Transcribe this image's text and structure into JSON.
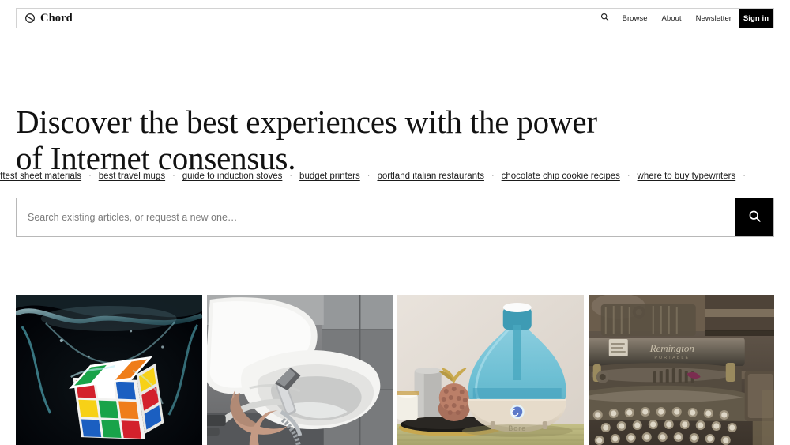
{
  "header": {
    "brand": "Chord",
    "brand_icon": "chord-circle-logo",
    "search_icon": "search-icon",
    "nav": [
      {
        "label": "Browse",
        "name": "nav-browse"
      },
      {
        "label": "About",
        "name": "nav-about"
      },
      {
        "label": "Newsletter",
        "name": "nav-newsletter"
      }
    ],
    "sign_in": "Sign in",
    "sign_in_bg": "#000000",
    "sign_in_fg": "#ffffff"
  },
  "hero": {
    "headline_line1": "Discover the best experiences with the power",
    "headline_line2": "of Internet consensus."
  },
  "ticker": {
    "separator": "·",
    "items": [
      "softest sheet materials",
      "best travel mugs",
      "guide to induction stoves",
      "budget printers",
      "portland italian restaurants",
      "chocolate chip cookie recipes",
      "where to buy typewriters"
    ]
  },
  "search": {
    "placeholder": "Search existing articles, or request a new one…",
    "value": "",
    "submit_icon": "search-icon",
    "submit_bg": "#000000"
  },
  "gallery": {
    "cards": [
      {
        "name": "card-rubiks-cube-water",
        "alt": "Rubik's cube splashing into dark water"
      },
      {
        "name": "card-bidet-sprayer-toilet",
        "alt": "Hand holding a bidet sprayer over a white toilet"
      },
      {
        "name": "card-humidifier",
        "alt": "Blue cool mist humidifier on a table with candles and pineapple decor"
      },
      {
        "name": "card-vintage-typewriter",
        "alt": "Dusty vintage Remington typewriter"
      }
    ]
  },
  "colors": {
    "page_bg": "#ffffff",
    "text": "#111111",
    "border": "#d2d2d2",
    "accent": "#000000",
    "placeholder": "#7b7b7b"
  }
}
